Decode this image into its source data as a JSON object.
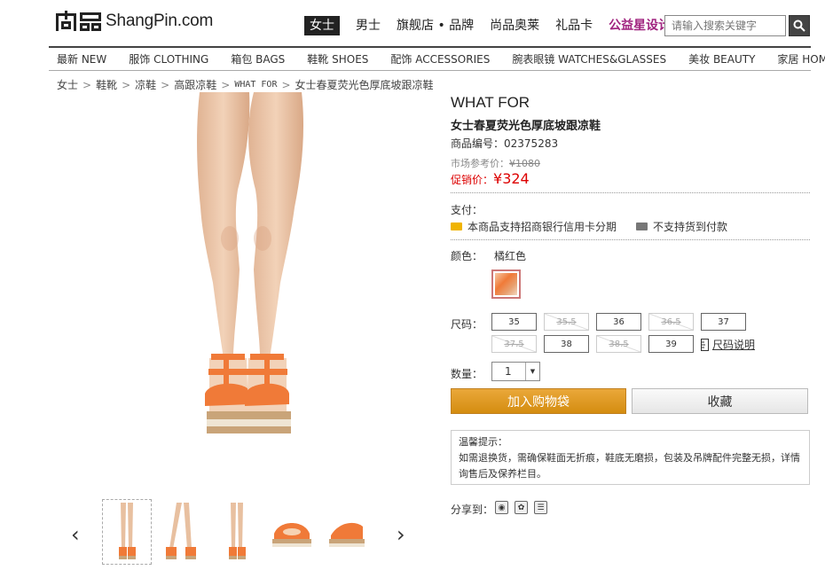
{
  "header": {
    "logo_text": "ShangPin.com",
    "top_nav": [
      {
        "label": "女士",
        "active": true
      },
      {
        "label": "男士"
      },
      {
        "label": "旗舰店 • 品牌"
      },
      {
        "label": "尚品奥莱"
      },
      {
        "label": "礼品卡"
      },
      {
        "label": "公益星设计",
        "highlight": "#a0237f"
      }
    ],
    "search_placeholder": "请输入搜索关键字"
  },
  "category_nav": [
    "最新 NEW",
    "服饰 CLOTHING",
    "箱包 BAGS",
    "鞋靴 SHOES",
    "配饰 ACCESSORIES",
    "腕表眼镜 WATCHES&GLASSES",
    "美妆 BEAUTY",
    "家居 HOME"
  ],
  "breadcrumb": [
    "女士",
    "鞋靴",
    "凉鞋",
    "高跟凉鞋",
    "WHAT FOR",
    "女士春夏荧光色厚底坡跟凉鞋"
  ],
  "product": {
    "brand": "WHAT FOR",
    "name": "女士春夏荧光色厚底坡跟凉鞋",
    "code_label": "商品编号：",
    "code": "02375283",
    "market_price_label": "市场参考价：",
    "market_price": "¥1080",
    "sale_price_label": "促销价：",
    "sale_price": "¥324",
    "payment_label": "支付：",
    "payment_options": [
      "本商品支持招商银行信用卡分期",
      "不支持货到付款"
    ],
    "color_label": "颜色：",
    "color_name": "橘红色",
    "size_label": "尺码：",
    "sizes": [
      {
        "label": "35",
        "available": true
      },
      {
        "label": "35.5",
        "available": false
      },
      {
        "label": "36",
        "available": true
      },
      {
        "label": "36.5",
        "available": false
      },
      {
        "label": "37",
        "available": true
      },
      {
        "label": "37.5",
        "available": false
      },
      {
        "label": "38",
        "available": true
      },
      {
        "label": "38.5",
        "available": false
      },
      {
        "label": "39",
        "available": true
      }
    ],
    "size_guide": "尺码说明",
    "qty_label": "数量：",
    "qty": "1",
    "add_to_cart": "加入购物袋",
    "favorite": "收藏",
    "tips_title": "温馨提示：",
    "tips_text": "如需退换货，需确保鞋面无折痕，鞋底无磨损，包装及吊牌配件完整无损，详情询售后及保养栏目。",
    "share_label": "分享到：",
    "accent_color": "#d00000",
    "cart_color": "#e09a25"
  },
  "thumbnails": {
    "prev": "‹",
    "next": "›",
    "count": 5
  }
}
